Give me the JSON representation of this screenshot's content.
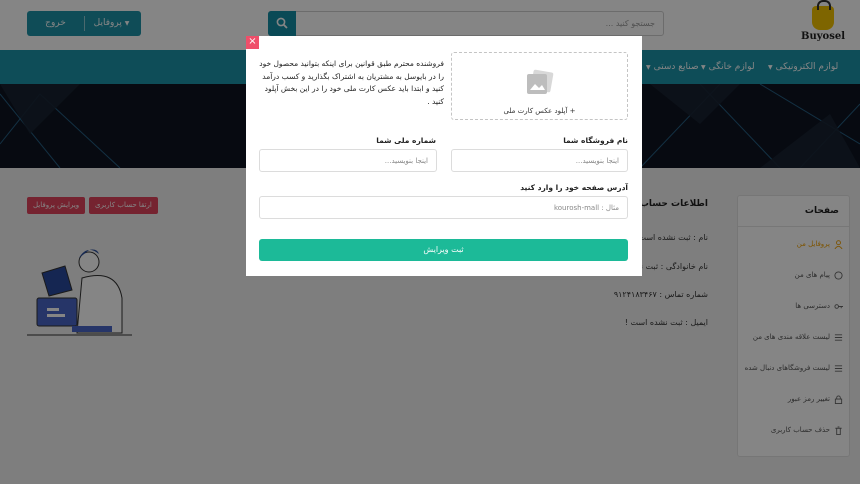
{
  "header": {
    "logo_text": "Buyosel",
    "search_placeholder": "جستجو کنید ...",
    "profile_label": "پروفایل",
    "logout_label": "خروج"
  },
  "nav": {
    "items": [
      {
        "label": "لوازم الکترونیکی"
      },
      {
        "label": "لوازم خانگی"
      },
      {
        "label": "صنایع دستی"
      }
    ]
  },
  "sidebar": {
    "title": "صفحات",
    "items": [
      {
        "label": "پروفایل من"
      },
      {
        "label": "پیام های من"
      },
      {
        "label": "دسترسی ها"
      },
      {
        "label": "لیست علاقه مندی های من"
      },
      {
        "label": "لیست فروشگاهای دنبال شده"
      },
      {
        "label": "تغییر رمز عبور"
      },
      {
        "label": "حذف حساب کاربری"
      }
    ]
  },
  "info": {
    "title": "اطلاعات حساب مر",
    "name": "نام : ثبت نشده است !",
    "family": "نام خانوادگی : ثبت نش",
    "phone": "شماره تماس : ۹۱۲۴۱۸۳۴۶۷",
    "email": "ایمیل : ثبت نشده است !"
  },
  "actions": {
    "upgrade": "ارتقا حساب کاربری",
    "edit_profile": "ویرایش پروفایل"
  },
  "modal": {
    "close": "×",
    "upload_label": "+ آپلود عکس کارت ملی",
    "notice": "فروشنده محترم طبق قوانین برای اینکه بتوانید محصول خود را در بایوسل به مشتریان به اشتراک بگذارید و کسب درآمد کنید و ابتدا باید عکس کارت ملی خود را در این بخش آپلود کنید .",
    "store_name_label": "نام فروشگاه شما",
    "store_name_placeholder": "اینجا بنویسید...",
    "national_id_label": "شماره ملی شما",
    "national_id_placeholder": "اینجا بنویسید...",
    "address_label": "آدرس صفحه خود را وارد کنید",
    "address_placeholder": "مثال : kourosh-mall",
    "submit_label": "ثبت ویرایش"
  },
  "colors": {
    "primary": "#1b95aa",
    "success": "#1cba98",
    "danger": "#e0445d",
    "accent": "#f0a000"
  }
}
